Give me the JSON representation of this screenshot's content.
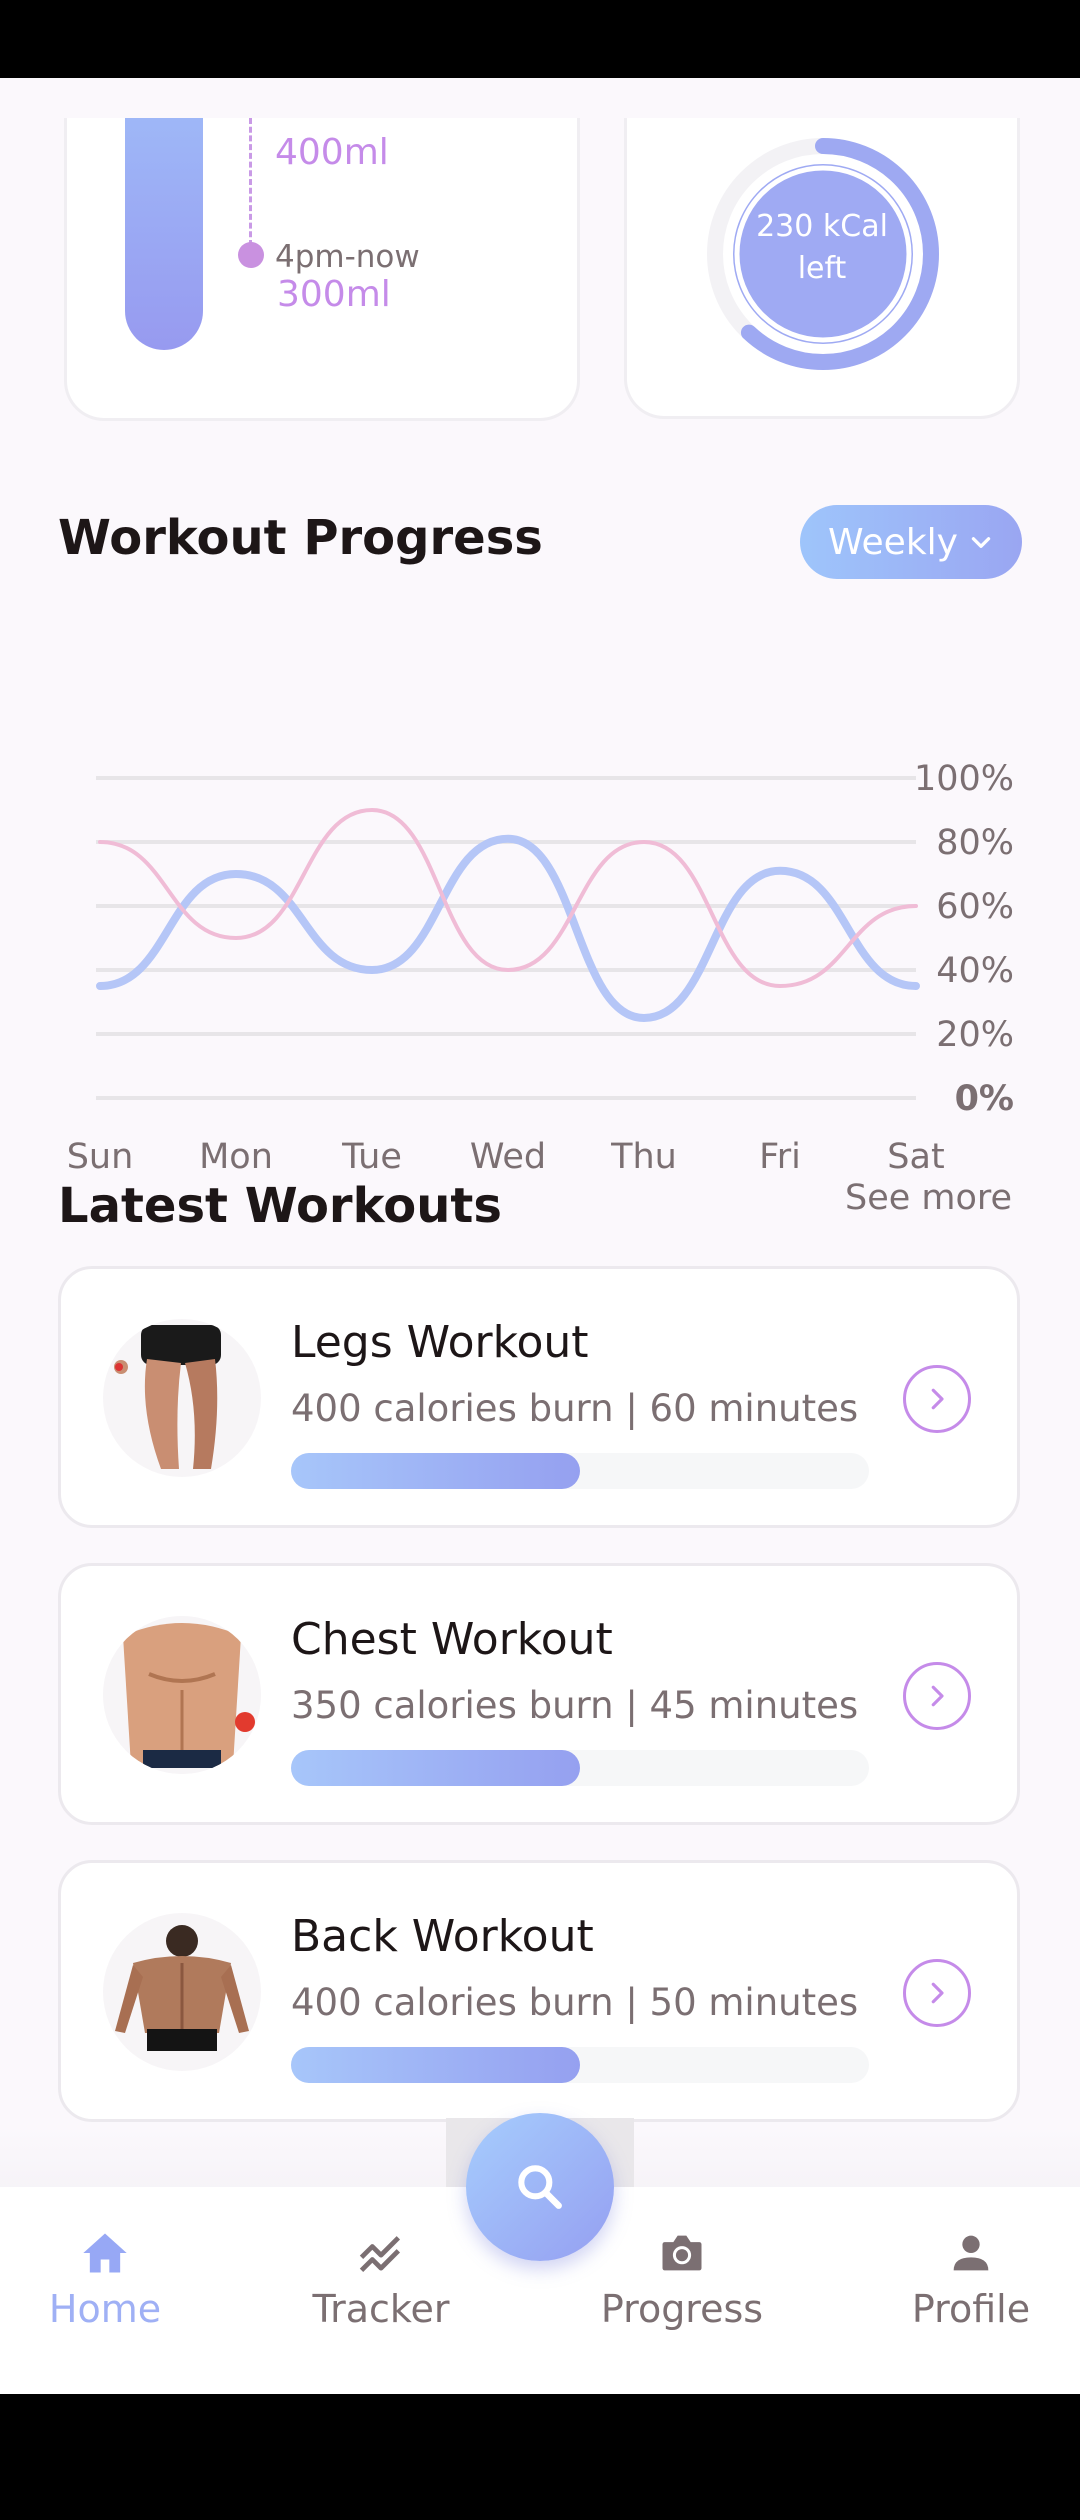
{
  "water": {
    "intake_1": "400ml",
    "time_2": "4pm-now",
    "intake_2": "300ml"
  },
  "calories": {
    "line1": "230 kCal",
    "line2": "left",
    "progress_fraction": 0.62
  },
  "workout_progress": {
    "title": "Workout Progress",
    "period_label": "Weekly"
  },
  "chart_data": {
    "type": "line",
    "categories": [
      "Sun",
      "Mon",
      "Tue",
      "Wed",
      "Thu",
      "Fri",
      "Sat"
    ],
    "y_tick_labels": [
      "100%",
      "80%",
      "60%",
      "40%",
      "20%",
      "0%"
    ],
    "ylim": [
      0,
      100
    ],
    "grid": true,
    "series": [
      {
        "color": "#b5c6f7",
        "values": [
          35,
          70,
          40,
          81,
          25,
          71,
          35
        ]
      },
      {
        "color": "#f0bcd6",
        "values": [
          80,
          50,
          90,
          40,
          80,
          35,
          60
        ]
      }
    ]
  },
  "latest_workouts": {
    "title": "Latest Workouts",
    "see_more": "See more",
    "items": [
      {
        "title": "Legs Workout",
        "subtitle": "400 calories burn | 60 minutes",
        "progress": 0.5
      },
      {
        "title": "Chest Workout",
        "subtitle": "350 calories burn | 45 minutes",
        "progress": 0.5
      },
      {
        "title": "Back Workout",
        "subtitle": "400 calories burn | 50 minutes",
        "progress": 0.5
      }
    ]
  },
  "nav": {
    "home": "Home",
    "tracker": "Tracker",
    "progress": "Progress",
    "profile": "Profile"
  },
  "colors": {
    "accent_blue": "#9aa6f2",
    "accent_purple": "#c58be9",
    "text_dark": "#1d1617",
    "text_gray": "#7b6f72"
  }
}
